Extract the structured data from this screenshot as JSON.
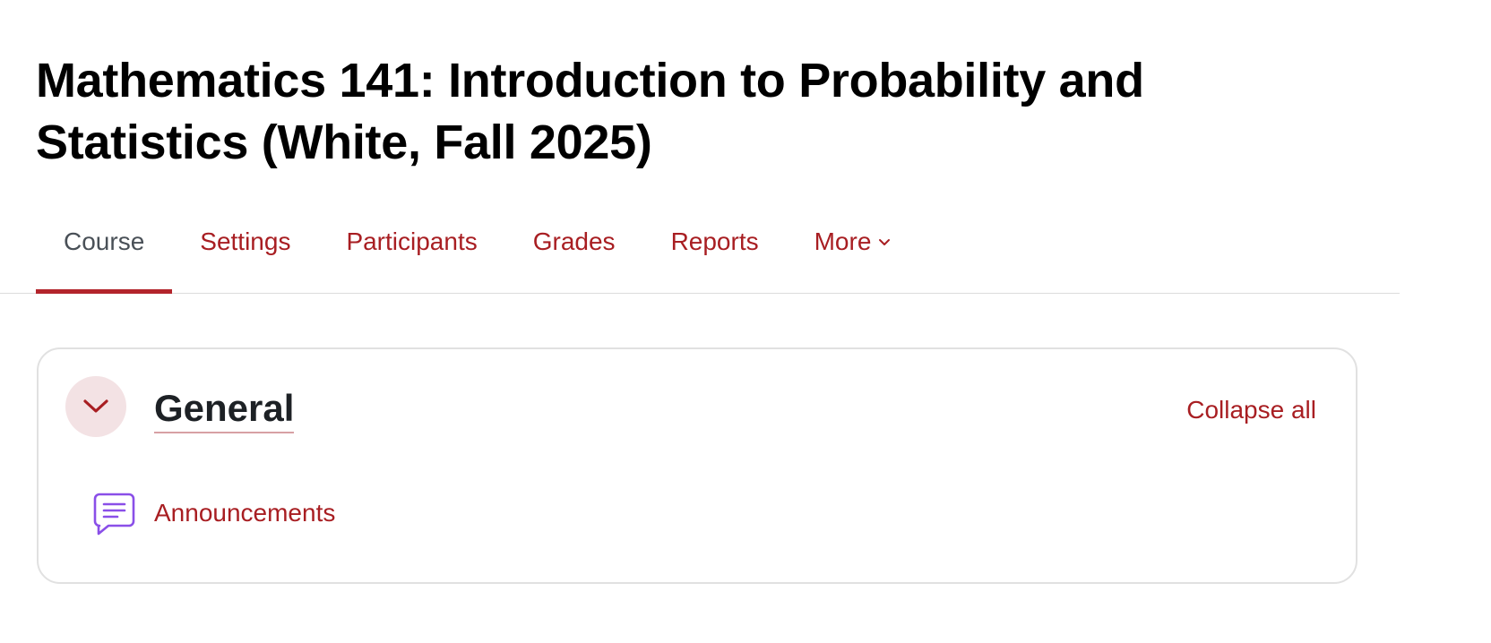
{
  "course": {
    "title": "Mathematics 141: Introduction to Probability and Statistics (White, Fall 2025)"
  },
  "nav": {
    "items": [
      {
        "label": "Course",
        "active": true
      },
      {
        "label": "Settings"
      },
      {
        "label": "Participants"
      },
      {
        "label": "Grades"
      },
      {
        "label": "Reports"
      },
      {
        "label": "More"
      }
    ]
  },
  "section": {
    "title": "General",
    "collapse_all_label": "Collapse all",
    "activities": [
      {
        "name": "Announcements",
        "icon": "forum-icon"
      }
    ]
  },
  "colors": {
    "accent": "#a81e22",
    "active_tab_text": "#495057",
    "active_underline": "#b3242b",
    "toggle_bg": "#f3e2e4",
    "forum_icon": "#8a4fe8"
  }
}
